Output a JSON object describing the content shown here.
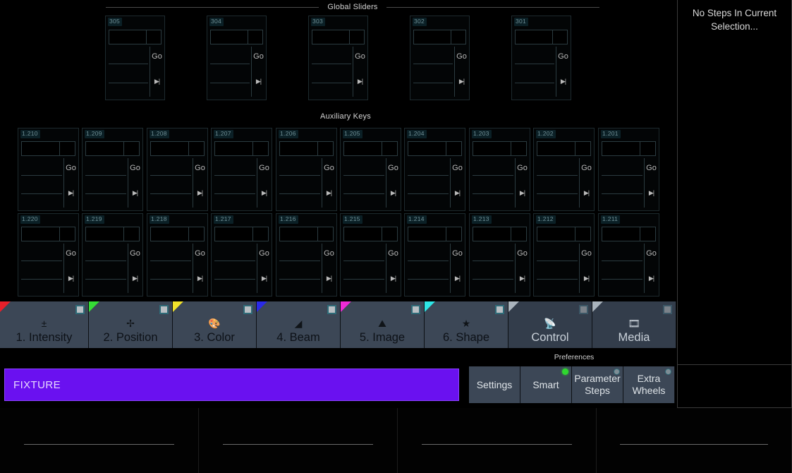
{
  "global_sliders": {
    "title": "Global Sliders",
    "go_label": "Go",
    "next_label": "▶|",
    "items": [
      {
        "id": "305"
      },
      {
        "id": "304"
      },
      {
        "id": "303"
      },
      {
        "id": "302"
      },
      {
        "id": "301"
      }
    ]
  },
  "auxiliary_keys": {
    "title": "Auxiliary Keys",
    "go_label": "Go",
    "next_label": "▶|",
    "row1": [
      {
        "id": "1.210"
      },
      {
        "id": "1.209"
      },
      {
        "id": "1.208"
      },
      {
        "id": "1.207"
      },
      {
        "id": "1.206"
      },
      {
        "id": "1.205"
      },
      {
        "id": "1.204"
      },
      {
        "id": "1.203"
      },
      {
        "id": "1.202"
      },
      {
        "id": "1.201"
      }
    ],
    "row2": [
      {
        "id": "1.220"
      },
      {
        "id": "1.219"
      },
      {
        "id": "1.218"
      },
      {
        "id": "1.217"
      },
      {
        "id": "1.216"
      },
      {
        "id": "1.215"
      },
      {
        "id": "1.214"
      },
      {
        "id": "1.213"
      },
      {
        "id": "1.212"
      },
      {
        "id": "1.211"
      }
    ]
  },
  "tabs": [
    {
      "label": "1. Intensity",
      "icon": "plus-minus-icon",
      "glyph": "±",
      "corner": "#e8202a",
      "active": true
    },
    {
      "label": "2. Position",
      "icon": "crosshair-icon",
      "glyph": "✢",
      "corner": "#35dd35",
      "active": true
    },
    {
      "label": "3. Color",
      "icon": "palette-icon",
      "glyph": "🎨",
      "corner": "#f2e32c",
      "active": true
    },
    {
      "label": "4. Beam",
      "icon": "beam-cone-icon",
      "glyph": "◢",
      "corner": "#2a2ae8",
      "active": true
    },
    {
      "label": "5. Image",
      "icon": "gobo-image-icon",
      "glyph": "⛰",
      "corner": "#ef2ad6",
      "active": true
    },
    {
      "label": "6. Shape",
      "icon": "star-icon",
      "glyph": "★",
      "corner": "#2ee6e6",
      "active": true
    },
    {
      "label": "Control",
      "icon": "satellite-icon",
      "glyph": "📡",
      "corner": "#aab4bd",
      "active": false
    },
    {
      "label": "Media",
      "icon": "filmstrip-icon",
      "glyph": "🎞",
      "corner": "#aab4bd",
      "active": false
    }
  ],
  "fixture_bar": {
    "label": "FIXTURE",
    "color": "#6a11f0"
  },
  "preferences": {
    "title": "Preferences",
    "buttons": [
      {
        "label": "Settings",
        "led": "none"
      },
      {
        "label": "Smart",
        "led": "on"
      },
      {
        "label": "Parameter Steps",
        "line1": "Parameter",
        "line2": "Steps",
        "led": "off"
      },
      {
        "label": "Extra Wheels",
        "line1": "Extra",
        "line2": "Wheels",
        "led": "off"
      }
    ]
  },
  "right_panel": {
    "message": "No Steps In Current Selection..."
  },
  "encoders": {
    "count": 4
  }
}
